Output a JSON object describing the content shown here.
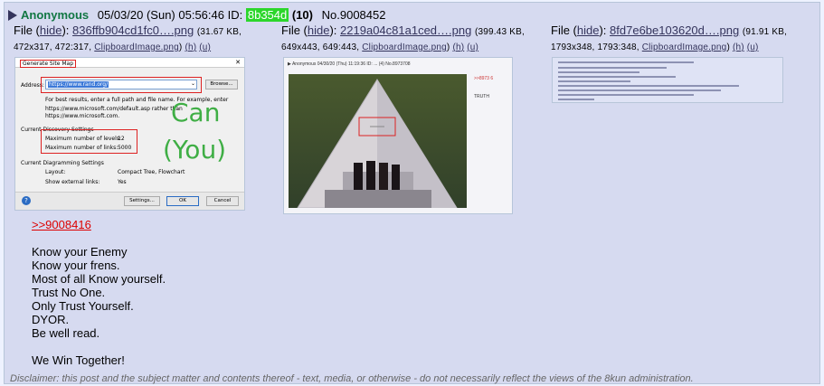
{
  "intro": {
    "name": "Anonymous",
    "date": "05/03/20 (Sun) 05:56:46",
    "id_label": "ID:",
    "id": "8b354d",
    "id_count": "(10)",
    "post_no": "No.9008452",
    "id_color": "#2bd62b",
    "name_color": "#117743"
  },
  "files": [
    {
      "file_label": "File (",
      "hide": "hide",
      "colon": "):",
      "name": "836ffb904cd1fc0….png",
      "meta_open": "(31.67 KB,",
      "meta_line2": "472x317, 472:317,",
      "orig_name": "ClipboardImage.png",
      "h": "(h)",
      "u": "(u)"
    },
    {
      "file_label": "File (",
      "hide": "hide",
      "colon": "):",
      "name": "2219a04c81a1ced….png",
      "meta_open": "(399.43 KB,",
      "meta_line2": "649x443, 649:443,",
      "orig_name": "ClipboardImage.png",
      "h": "(h)",
      "u": "(u)"
    },
    {
      "file_label": "File (",
      "hide": "hide",
      "colon": "):",
      "name": "8fd7e6be103620d….png",
      "meta_open": "(91.91 KB,",
      "meta_line2": "1793x348, 1793:348,",
      "orig_name": "ClipboardImage.png",
      "h": "(h)",
      "u": "(u)"
    }
  ],
  "thumb1": {
    "dialog_title": "Generate Site Map",
    "address_label": "Address:",
    "address_value": "https://www.rand.org/",
    "browse": "Browse...",
    "hint1": "For best results, enter a full path and file name. For example, enter",
    "hint2": "https://www.microsoft.com/default.asp rather than",
    "hint3": "https://www.microsoft.com.",
    "section1": "Current Discovery Settings",
    "levels_label": "Maximum number of levels:",
    "levels_value": "12",
    "links_label": "Maximum number of links:",
    "links_value": "5000",
    "section2": "Current Diagramming Settings",
    "layout_label": "Layout:",
    "layout_value": "Compact Tree, Flowchart",
    "external_label": "Show external links:",
    "external_value": "Yes",
    "settings_btn": "Settings...",
    "ok_btn": "OK",
    "cancel_btn": "Cancel",
    "overlay1": "Can",
    "overlay2": "(You)"
  },
  "thumb2": {
    "header": "▶ Anonymous 04/30/20 (Thu) 11:19:36 ID: ... (4) No.8973708",
    "side_link": ">>8973\n6",
    "side_text": "TRUTH"
  },
  "message": {
    "quote": ">>9008416",
    "lines": [
      "Know your Enemy",
      "Know your frens.",
      "Most of all Know yourself.",
      "Trust No One.",
      "Only Trust Yourself.",
      "DYOR.",
      "Be well read."
    ],
    "closing": "We Win Together!"
  },
  "disclaimer": "Disclaimer: this post and the subject matter and contents thereof - text, media, or otherwise - do not necessarily reflect the views of the 8kun administration."
}
